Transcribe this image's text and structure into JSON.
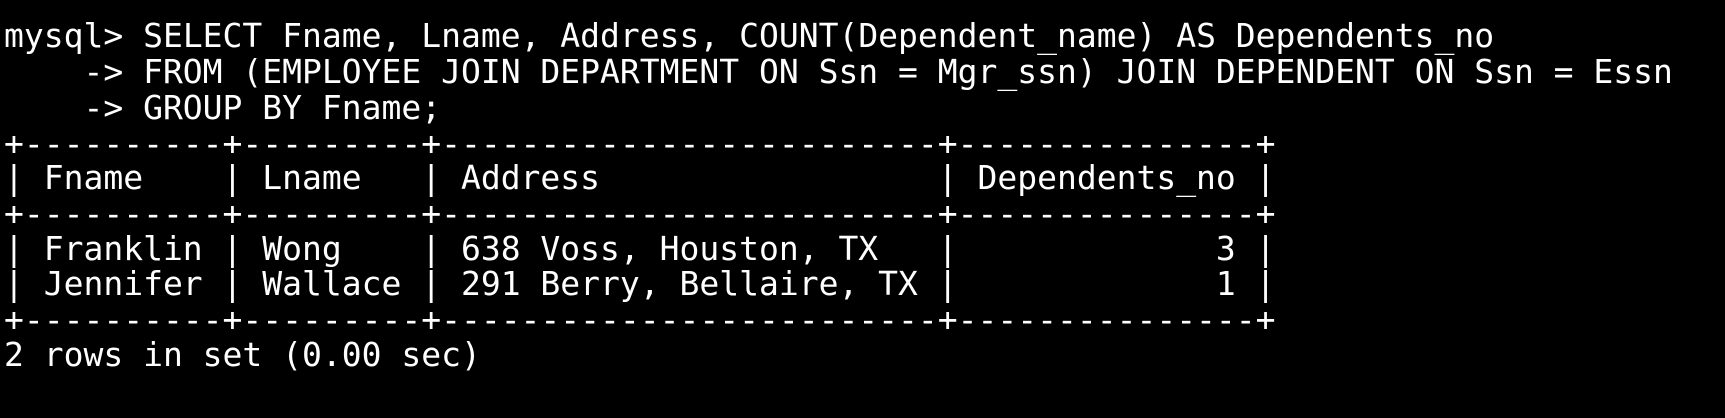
{
  "terminal": {
    "prompt": "mysql> ",
    "query": [
      "SELECT Fname, Lname, Address, COUNT(Dependent_name) AS Dependents_no",
      "    -> FROM (EMPLOYEE JOIN DEPARTMENT ON Ssn = Mgr_ssn) JOIN DEPENDENT ON Ssn = Essn",
      "    -> GROUP BY Fname;"
    ],
    "table": {
      "border": "+----------+---------+-------------------------+---------------+",
      "header": "| Fname    | Lname   | Address                 | Dependents_no |",
      "rows": [
        "| Franklin | Wong    | 638 Voss, Houston, TX   |             3 |",
        "| Jennifer | Wallace | 291 Berry, Bellaire, TX |             1 |"
      ]
    },
    "status": "2 rows in set (0.00 sec)"
  }
}
